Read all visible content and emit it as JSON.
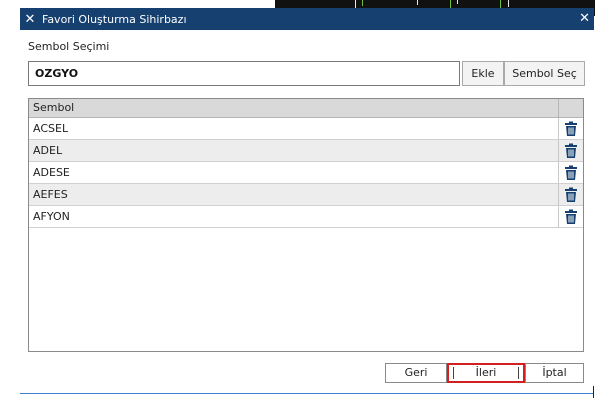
{
  "window": {
    "title": "Favori Oluşturma Sihirbazı",
    "close_left": "✕",
    "close_right": "✕"
  },
  "symbol_section": {
    "label": "Sembol Seçimi",
    "input_value": "OZGYO",
    "add_button": "Ekle",
    "select_button": "Sembol Seç"
  },
  "grid": {
    "column_header": "Sembol",
    "rows": [
      "ACSEL",
      "ADEL",
      "ADESE",
      "AEFES",
      "AFYON"
    ],
    "delete_icon": "trash-icon"
  },
  "footer": {
    "back_button": "Geri",
    "next_button": "İleri",
    "cancel_button": "İptal"
  },
  "colors": {
    "titlebar": "#15406f",
    "highlight": "#d21f1f",
    "trash": "#15406f"
  }
}
